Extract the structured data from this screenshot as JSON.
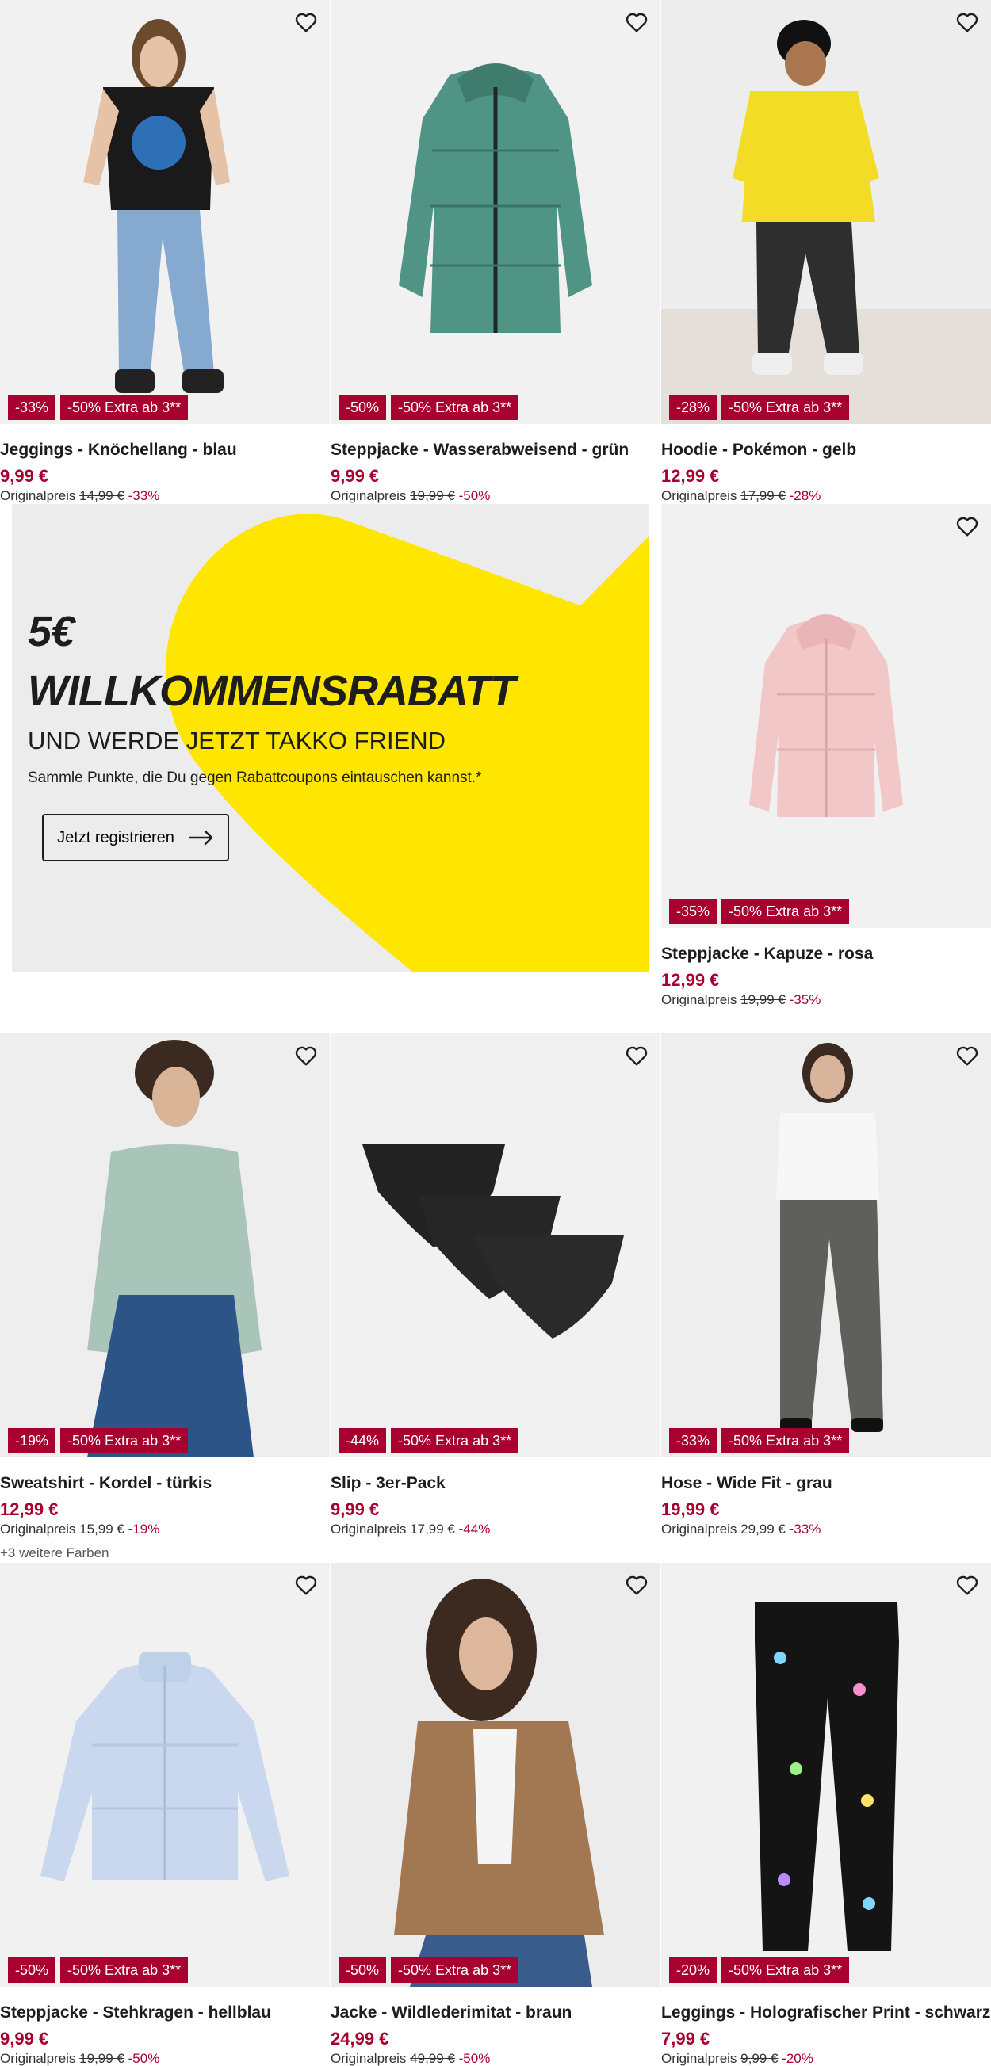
{
  "colors": {
    "accent": "#a8002f",
    "promo_yellow": "#ffe600",
    "promo_bg": "#ececec"
  },
  "products": [
    {
      "title": "Jeggings - Knöchellang - blau",
      "price": "9,99 €",
      "orig_label": "Originalpreis",
      "orig_price": "14,99 €",
      "orig_pct": "-33%",
      "badges": [
        "-33%",
        "-50% Extra ab 3**"
      ],
      "image": "girl-black-tshirt-jeans"
    },
    {
      "title": "Steppjacke - Wasserabweisend - grün",
      "price": "9,99 €",
      "orig_label": "Originalpreis",
      "orig_price": "19,99 €",
      "orig_pct": "-50%",
      "badges": [
        "-50%",
        "-50% Extra ab 3**"
      ],
      "image": "green-puffer-jacket"
    },
    {
      "title": "Hoodie - Pokémon - gelb",
      "price": "12,99 €",
      "orig_label": "Originalpreis",
      "orig_price": "17,99 €",
      "orig_pct": "-28%",
      "badges": [
        "-28%",
        "-50% Extra ab 3**"
      ],
      "image": "child-yellow-hoodie"
    },
    {
      "title": "Steppjacke - Kapuze - rosa",
      "price": "12,99 €",
      "orig_label": "Originalpreis",
      "orig_price": "19,99 €",
      "orig_pct": "-35%",
      "badges": [
        "-35%",
        "-50% Extra ab 3**"
      ],
      "image": "pink-puffer-jacket"
    },
    {
      "title": "Sweatshirt - Kordel - türkis",
      "price": "12,99 €",
      "orig_label": "Originalpreis",
      "orig_price": "15,99 €",
      "orig_pct": "-19%",
      "badges": [
        "-19%",
        "-50% Extra ab 3**"
      ],
      "more_colors": "+3 weitere Farben",
      "image": "woman-mint-sweatshirt"
    },
    {
      "title": "Slip - 3er-Pack",
      "price": "9,99 €",
      "orig_label": "Originalpreis",
      "orig_price": "17,99 €",
      "orig_pct": "-44%",
      "badges": [
        "-44%",
        "-50% Extra ab 3**"
      ],
      "image": "black-briefs-3-pack"
    },
    {
      "title": "Hose - Wide Fit - grau",
      "price": "19,99 €",
      "orig_label": "Originalpreis",
      "orig_price": "29,99 €",
      "orig_pct": "-33%",
      "badges": [
        "-33%",
        "-50% Extra ab 3**"
      ],
      "image": "woman-grey-wide-trousers"
    },
    {
      "title": "Steppjacke - Stehkragen - hellblau",
      "price": "9,99 €",
      "orig_label": "Originalpreis",
      "orig_price": "19,99 €",
      "orig_pct": "-50%",
      "badges": [
        "-50%",
        "-50% Extra ab 3**"
      ],
      "image": "light-blue-puffer-jacket"
    },
    {
      "title": "Jacke - Wildlederimitat - braun",
      "price": "24,99 €",
      "orig_label": "Originalpreis",
      "orig_price": "49,99 €",
      "orig_pct": "-50%",
      "badges": [
        "-50%",
        "-50% Extra ab 3**"
      ],
      "image": "woman-brown-suede-jacket"
    },
    {
      "title": "Leggings - Holografischer Print - schwarz",
      "price": "7,99 €",
      "orig_label": "Originalpreis",
      "orig_price": "9,99 €",
      "orig_pct": "-20%",
      "badges": [
        "-20%",
        "-50% Extra ab 3**"
      ],
      "image": "black-unicorn-leggings"
    }
  ],
  "promo": {
    "amount": "5€",
    "headline": "WILLKOMMENSRABATT",
    "subheadline": "UND WERDE JETZT TAKKO FRIEND",
    "description": "Sammle Punkte, die Du gegen Rabattcoupons eintauschen kannst.*",
    "cta_label": "Jetzt registrieren"
  }
}
